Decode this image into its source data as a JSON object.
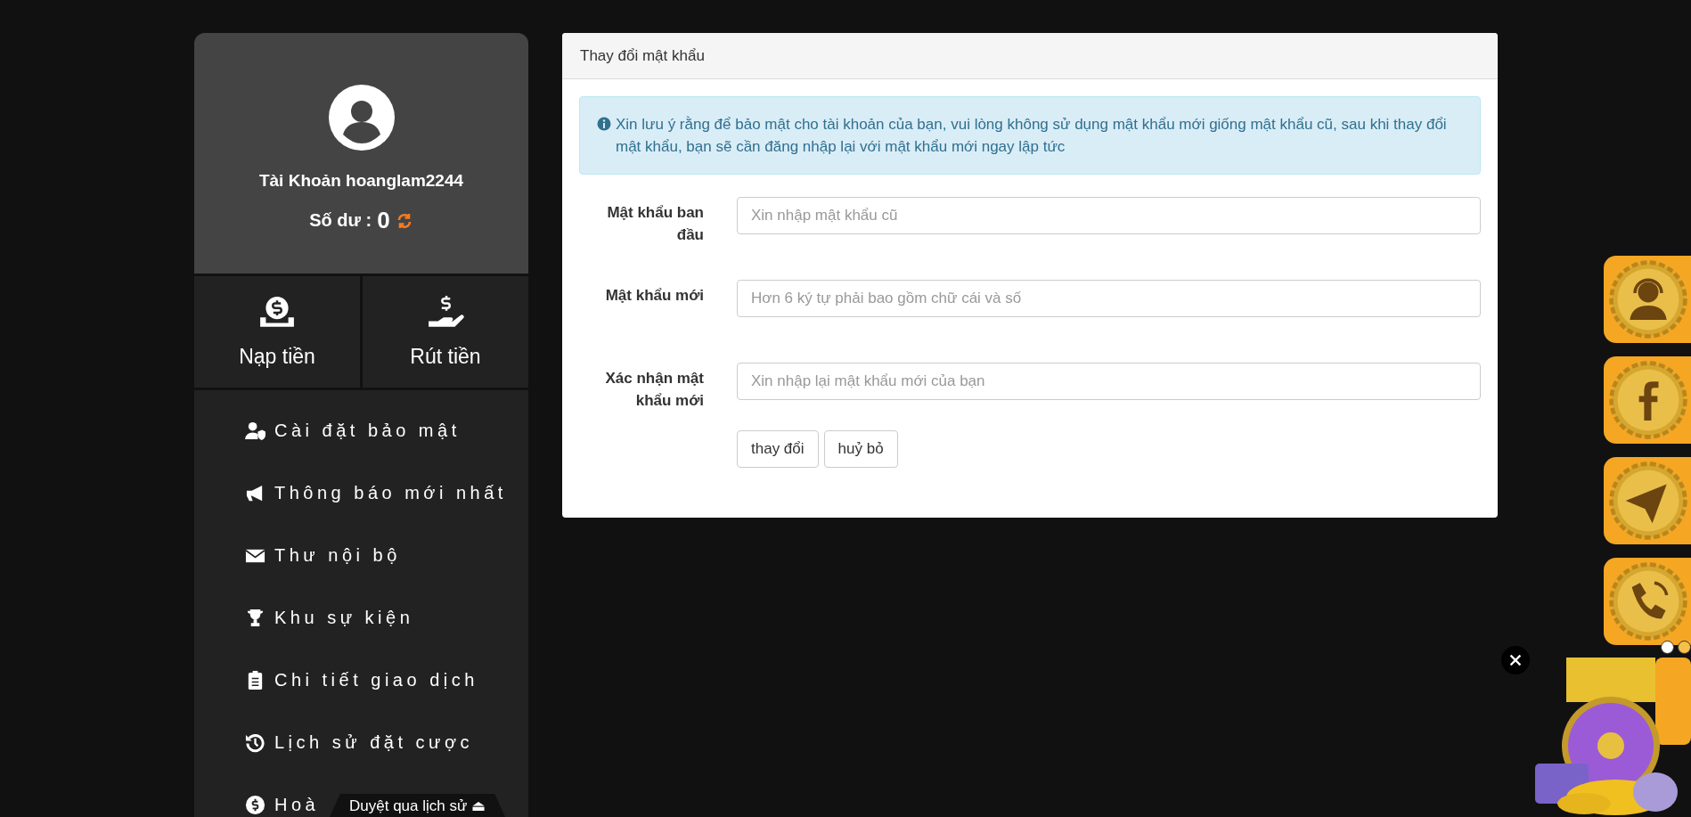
{
  "profile": {
    "account": "Tài Khoản hoanglam2244",
    "balance_label": "Số dư :",
    "balance": "0"
  },
  "actions": [
    {
      "kind": "deposit",
      "label": "Nạp tiền"
    },
    {
      "kind": "withdraw",
      "label": "Rút tiền"
    }
  ],
  "menu": [
    {
      "kind": "security",
      "label": "Cài đặt bảo mật"
    },
    {
      "kind": "announce",
      "label": "Thông báo mới nhất"
    },
    {
      "kind": "mail",
      "label": "Thư nội bộ"
    },
    {
      "kind": "trophy",
      "label": "Khu sự kiện"
    },
    {
      "kind": "clipboard",
      "label": "Chi tiết giao dịch"
    },
    {
      "kind": "history",
      "label": "Lịch sử đặt cược"
    },
    {
      "kind": "dollar",
      "label": "Hoà"
    }
  ],
  "history_tab": {
    "label": "Duyệt qua lịch sử ⏏"
  },
  "panel": {
    "title": "Thay đổi mật khẩu",
    "notice": "Xin lưu ý rằng để bảo mật cho tài khoản của bạn, vui lòng không sử dụng mật khẩu mới giống mật khẩu cũ, sau khi thay đổi mật khẩu, bạn sẽ cần đăng nhập lại với mật khẩu mới ngay lập tức",
    "fields": [
      {
        "label": "Mật khẩu ban đầu",
        "placeholder": "Xin nhập mật khẩu cũ"
      },
      {
        "label": "Mật khẩu mới",
        "placeholder": "Hơn 6 ký tự phải bao gồm chữ cái và số"
      },
      {
        "label": "Xác nhận mật khẩu mới",
        "placeholder": "Xin nhập lại mật khẩu mới của bạn"
      }
    ],
    "buttons": [
      "thay đổi",
      "huỷ bỏ"
    ]
  },
  "float_buttons": [
    {
      "kind": "support"
    },
    {
      "kind": "facebook"
    },
    {
      "kind": "telegram"
    },
    {
      "kind": "phone"
    }
  ]
}
